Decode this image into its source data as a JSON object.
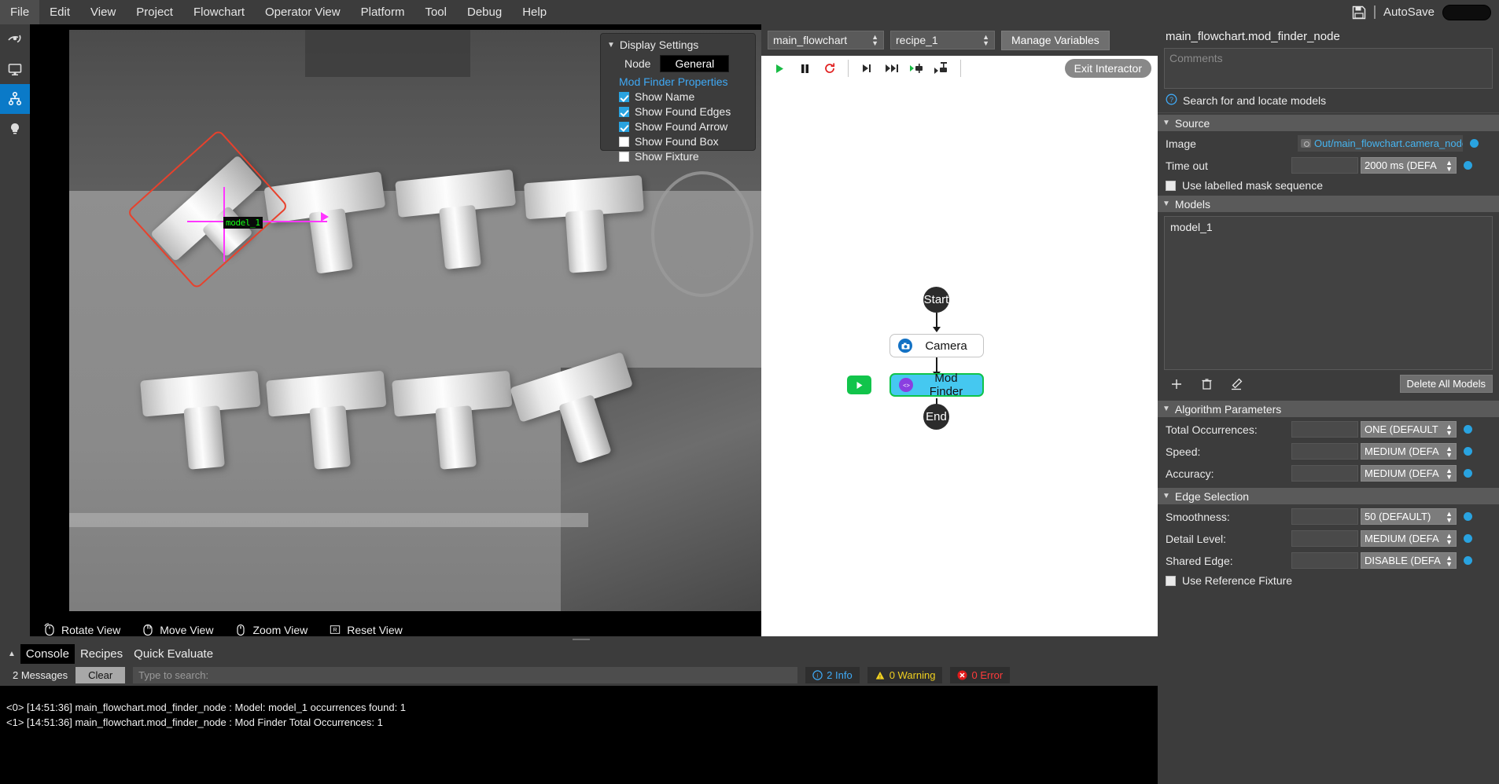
{
  "menubar": {
    "items": [
      "File",
      "Edit",
      "View",
      "Project",
      "Flowchart",
      "Operator View",
      "Platform",
      "Tool",
      "Debug",
      "Help"
    ],
    "save_icon": "save-disk-icon",
    "autosave_label": "AutoSave"
  },
  "rail": {
    "items": [
      {
        "icon": "vision-eye-icon",
        "name": "vision-view"
      },
      {
        "icon": "monitor-icon",
        "name": "display-view"
      },
      {
        "icon": "flowchart-hierarchy-icon",
        "name": "flowchart-view"
      },
      {
        "icon": "lightbulb-icon",
        "name": "hints-view"
      }
    ]
  },
  "viewer": {
    "overlay_label": "model_1",
    "controls": [
      {
        "label": "Rotate View",
        "icon": "mouse-rotate-icon"
      },
      {
        "label": "Move View",
        "icon": "mouse-move-icon"
      },
      {
        "label": "Zoom View",
        "icon": "mouse-zoom-icon"
      },
      {
        "label": "Reset View",
        "icon": "key-r-icon"
      }
    ]
  },
  "display_settings": {
    "title": "Display Settings",
    "node_label": "Node",
    "general_label": "General",
    "section_label": "Mod Finder Properties",
    "checkboxes": [
      {
        "label": "Show Name",
        "checked": true
      },
      {
        "label": "Show Found Edges",
        "checked": true
      },
      {
        "label": "Show Found Arrow",
        "checked": true
      },
      {
        "label": "Show Found Box",
        "checked": false
      },
      {
        "label": "Show Fixture",
        "checked": false
      }
    ]
  },
  "flow_toolbar": {
    "flowchart_select": "main_flowchart",
    "recipe_select": "recipe_1",
    "manage_variables": "Manage Variables",
    "exit_interactor": "Exit Interactor",
    "icons": [
      "play-icon",
      "pause-icon",
      "reload-icon",
      "step-into-icon",
      "step-over-icon",
      "run-node-icon",
      "run-from-node-icon"
    ]
  },
  "flowchart": {
    "nodes": [
      {
        "label": "Start",
        "type": "terminal"
      },
      {
        "label": "Camera",
        "type": "process",
        "icon": "camera-icon"
      },
      {
        "label": "Mod Finder",
        "type": "process",
        "icon": "mod-finder-icon",
        "selected": true
      },
      {
        "label": "End",
        "type": "terminal"
      }
    ],
    "run_chip_icon": "run-play-icon"
  },
  "properties": {
    "title": "main_flowchart.mod_finder_node",
    "comments_placeholder": "Comments",
    "help_text": "Search for and locate models",
    "source": {
      "header": "Source",
      "image_label": "Image",
      "image_value": "Out/main_flowchart.camera_node/image",
      "timeout_label": "Time out",
      "timeout_value": "2000 ms (DEFA",
      "mask_checkbox": "Use labelled mask sequence"
    },
    "models": {
      "header": "Models",
      "items": [
        "model_1"
      ],
      "add_icon": "plus-icon",
      "delete_icon": "trash-icon",
      "edit_icon": "pencil-icon",
      "delete_all_label": "Delete All Models"
    },
    "algorithm": {
      "header": "Algorithm Parameters",
      "rows": [
        {
          "label": "Total Occurrences:",
          "value": "ONE (DEFAULT"
        },
        {
          "label": "Speed:",
          "value": "MEDIUM (DEFA"
        },
        {
          "label": "Accuracy:",
          "value": "MEDIUM (DEFA"
        }
      ]
    },
    "edge": {
      "header": "Edge Selection",
      "rows": [
        {
          "label": "Smoothness:",
          "value": "50 (DEFAULT)"
        },
        {
          "label": "Detail Level:",
          "value": "MEDIUM (DEFA"
        },
        {
          "label": "Shared Edge:",
          "value": "DISABLE (DEFA"
        }
      ],
      "fixture_checkbox": "Use Reference Fixture"
    }
  },
  "console": {
    "tabs": [
      "Console",
      "Recipes",
      "Quick Evaluate"
    ],
    "active_tab": "Console",
    "message_count": "2 Messages",
    "clear_label": "Clear",
    "search_placeholder": "Type to search:",
    "badges": [
      {
        "label": "2 Info",
        "color": "#3fa9f5",
        "icon": "info-icon"
      },
      {
        "label": "0 Warning",
        "color": "#f0d020",
        "icon": "warning-icon"
      },
      {
        "label": "0 Error",
        "color": "#ff3b3b",
        "icon": "error-icon"
      }
    ],
    "lines": [
      "<0> [14:51:36] main_flowchart.mod_finder_node : Model: model_1 occurrences found: 1",
      "<1> [14:51:36] main_flowchart.mod_finder_node : Mod Finder Total Occurrences: 1"
    ]
  },
  "colors": {
    "accent_blue": "#29a3e0",
    "link_blue": "#46b4f0",
    "node_selected": "#45c8f0",
    "node_border_green": "#10c44a",
    "panel_bg": "#3c3c3c"
  }
}
